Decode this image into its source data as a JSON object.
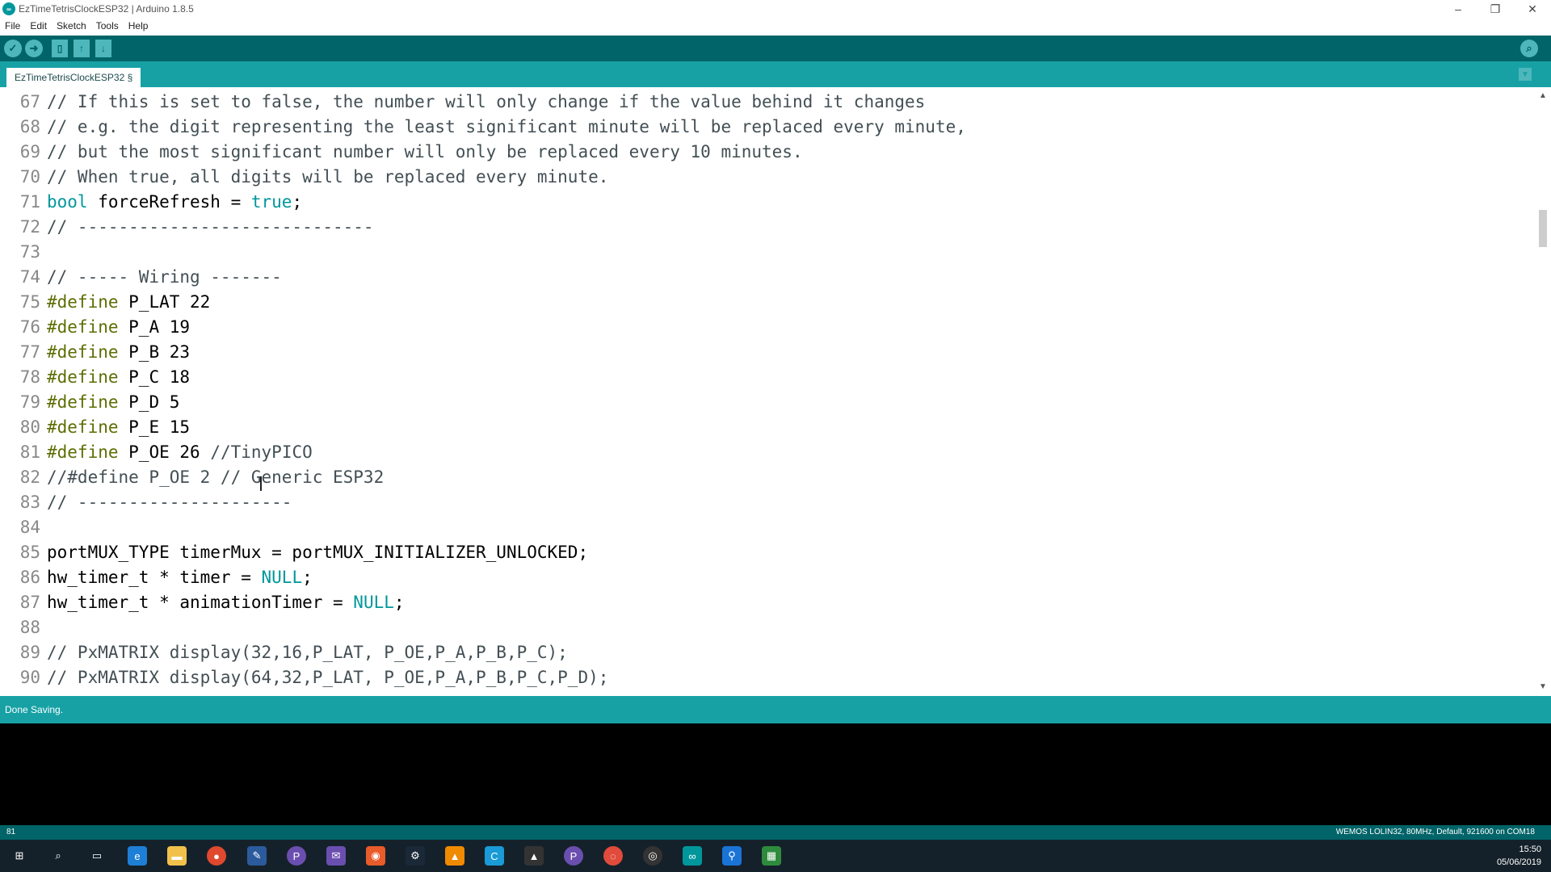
{
  "window": {
    "title": "EzTimeTetrisClockESP32 | Arduino 1.8.5",
    "app_icon": "arduino-logo",
    "controls": [
      "minimize",
      "restore",
      "close"
    ]
  },
  "menu": [
    "File",
    "Edit",
    "Sketch",
    "Tools",
    "Help"
  ],
  "toolbar": {
    "buttons": [
      "verify-icon",
      "upload-icon",
      "new-icon",
      "open-icon",
      "save-icon"
    ],
    "right_button": "serial-monitor-icon"
  },
  "tab": {
    "label": "EzTimeTetrisClockESP32 §"
  },
  "colors": {
    "toolbar": "#006468",
    "tabbar": "#17a1a5",
    "keyword": "#00979c",
    "preprocessor": "#5e6d03",
    "comment": "#434f54"
  },
  "editor": {
    "lines": [
      {
        "n": "67",
        "tokens": [
          {
            "t": "// If this is set to false, the number will only change if the value behind it changes",
            "k": "comment"
          }
        ]
      },
      {
        "n": "68",
        "tokens": [
          {
            "t": "// e.g. the digit representing the least significant minute will be replaced every minute,",
            "k": "comment"
          }
        ]
      },
      {
        "n": "69",
        "tokens": [
          {
            "t": "// but the most significant number will only be replaced every 10 minutes.",
            "k": "comment"
          }
        ]
      },
      {
        "n": "70",
        "tokens": [
          {
            "t": "// When true, all digits will be replaced every minute.",
            "k": "comment"
          }
        ]
      },
      {
        "n": "71",
        "tokens": [
          {
            "t": "bool",
            "k": "keyword"
          },
          {
            "t": " forceRefresh = ",
            "k": "plain"
          },
          {
            "t": "true",
            "k": "keyword"
          },
          {
            "t": ";",
            "k": "plain"
          }
        ]
      },
      {
        "n": "72",
        "tokens": [
          {
            "t": "// -----------------------------",
            "k": "comment"
          }
        ]
      },
      {
        "n": "73",
        "tokens": []
      },
      {
        "n": "74",
        "tokens": [
          {
            "t": "// ----- Wiring -------",
            "k": "comment"
          }
        ]
      },
      {
        "n": "75",
        "tokens": [
          {
            "t": "#define",
            "k": "pre"
          },
          {
            "t": " P_LAT 22",
            "k": "plain"
          }
        ]
      },
      {
        "n": "76",
        "tokens": [
          {
            "t": "#define",
            "k": "pre"
          },
          {
            "t": " P_A 19",
            "k": "plain"
          }
        ]
      },
      {
        "n": "77",
        "tokens": [
          {
            "t": "#define",
            "k": "pre"
          },
          {
            "t": " P_B 23",
            "k": "plain"
          }
        ]
      },
      {
        "n": "78",
        "tokens": [
          {
            "t": "#define",
            "k": "pre"
          },
          {
            "t": " P_C 18",
            "k": "plain"
          }
        ]
      },
      {
        "n": "79",
        "tokens": [
          {
            "t": "#define",
            "k": "pre"
          },
          {
            "t": " P_D 5",
            "k": "plain"
          }
        ]
      },
      {
        "n": "80",
        "tokens": [
          {
            "t": "#define",
            "k": "pre"
          },
          {
            "t": " P_E 15",
            "k": "plain"
          }
        ]
      },
      {
        "n": "81",
        "tokens": [
          {
            "t": "#define",
            "k": "pre"
          },
          {
            "t": " P_OE 26 ",
            "k": "plain"
          },
          {
            "t": "//TinyPICO",
            "k": "comment"
          }
        ]
      },
      {
        "n": "82",
        "tokens": [
          {
            "t": "//#define P_OE 2 // Generic ESP32",
            "k": "comment"
          }
        ]
      },
      {
        "n": "83",
        "tokens": [
          {
            "t": "// ---------------------",
            "k": "comment"
          }
        ]
      },
      {
        "n": "84",
        "tokens": []
      },
      {
        "n": "85",
        "tokens": [
          {
            "t": "portMUX_TYPE timerMux = portMUX_INITIALIZER_UNLOCKED;",
            "k": "plain"
          }
        ]
      },
      {
        "n": "86",
        "tokens": [
          {
            "t": "hw_timer_t * timer = ",
            "k": "plain"
          },
          {
            "t": "NULL",
            "k": "keyword"
          },
          {
            "t": ";",
            "k": "plain"
          }
        ]
      },
      {
        "n": "87",
        "tokens": [
          {
            "t": "hw_timer_t * animationTimer = ",
            "k": "plain"
          },
          {
            "t": "NULL",
            "k": "keyword"
          },
          {
            "t": ";",
            "k": "plain"
          }
        ]
      },
      {
        "n": "88",
        "tokens": []
      },
      {
        "n": "89",
        "tokens": [
          {
            "t": "// PxMATRIX display(32,16,P_LAT, P_OE,P_A,P_B,P_C);",
            "k": "comment"
          }
        ]
      },
      {
        "n": "90",
        "tokens": [
          {
            "t": "// PxMATRIX display(64,32,P_LAT, P_OE,P_A,P_B,P_C,P_D);",
            "k": "comment"
          }
        ]
      }
    ]
  },
  "status": {
    "message": "Done Saving.",
    "line_number": "81",
    "board": "WEMOS LOLIN32, 80MHz, Default, 921600 on COM18"
  },
  "taskbar": {
    "icons": [
      "windows-start-icon",
      "search-icon",
      "task-view-icon",
      "edge-icon",
      "file-explorer-icon",
      "chrome-icon",
      "app-icon",
      "app-icon",
      "mail-icon",
      "maps-icon",
      "steam-icon",
      "vlc-icon",
      "app-icon",
      "photos-icon",
      "app-icon",
      "app-icon",
      "obs-icon",
      "arduino-icon",
      "location-icon",
      "spreadsheet-icon"
    ],
    "time": "15:50",
    "date": "05/06/2019"
  }
}
